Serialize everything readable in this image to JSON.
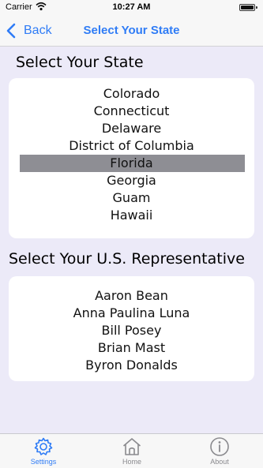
{
  "status_bar": {
    "carrier": "Carrier",
    "time": "10:27 AM"
  },
  "nav": {
    "back_label": "Back",
    "title": "Select Your State"
  },
  "state_section": {
    "title": "Select Your State",
    "items": [
      "Colorado",
      "Connecticut",
      "Delaware",
      "District of Columbia",
      "Florida",
      "Georgia",
      "Guam",
      "Hawaii"
    ],
    "selected": "Florida"
  },
  "rep_section": {
    "title": "Select Your U.S. Representative",
    "items": [
      "Aaron Bean",
      "Anna Paulina Luna",
      "Bill Posey",
      "Brian Mast",
      "Byron Donalds"
    ]
  },
  "tabs": [
    {
      "label": "Settings",
      "icon": "gear-icon",
      "active": true
    },
    {
      "label": "Home",
      "icon": "home-icon",
      "active": false
    },
    {
      "label": "About",
      "icon": "info-icon",
      "active": false
    }
  ],
  "colors": {
    "accent": "#2F7CF6",
    "background": "#ECEAF8",
    "selection": "#8E8E94"
  }
}
